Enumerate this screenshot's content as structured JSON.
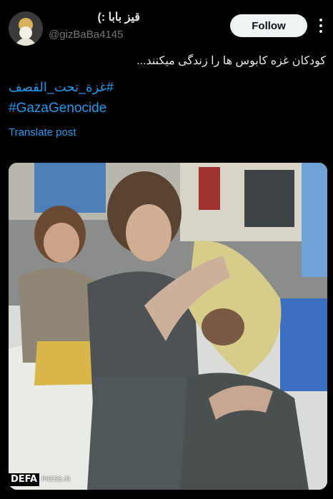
{
  "post": {
    "display_name": "قیز بابا :)",
    "handle": "@gizBaBa4145",
    "follow_label": "Follow",
    "text": "کودکان غزه کابوس ها را زندگی میکنند...",
    "hashtags": [
      "#غزة_تحت_القصف",
      "#GazaGenocide"
    ],
    "translate_label": "Translate post"
  },
  "media": {
    "watermark_brand": "DEFA",
    "watermark_site": "PRESS.IR"
  },
  "colors": {
    "background": "#000000",
    "link": "#1d9bf0",
    "follow_bg": "#eff3f4"
  }
}
